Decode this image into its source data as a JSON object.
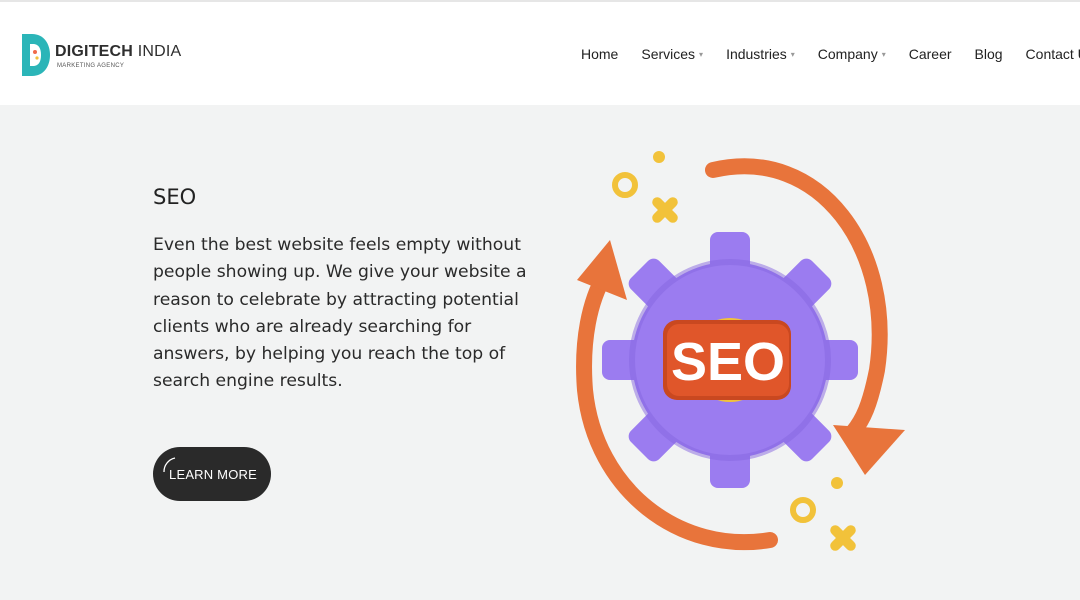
{
  "brand": {
    "name_bold": "DIGITECH",
    "name_rest": " INDIA",
    "tagline": "MARKETING AGENCY",
    "logo_color": "#2bb5b8"
  },
  "nav": {
    "items": [
      {
        "label": "Home"
      },
      {
        "label": "Services",
        "dropdown": true
      },
      {
        "label": "Industries",
        "dropdown": true
      },
      {
        "label": "Company",
        "dropdown": true
      },
      {
        "label": "Career"
      },
      {
        "label": "Blog"
      },
      {
        "label": "Contact Us"
      }
    ]
  },
  "hero": {
    "title": "SEO",
    "description": "Even the best website feels empty without people showing up. We give your website a reason to celebrate by attracting potential clients who are already searching for answers, by helping you reach the top of search engine results.",
    "button_label": "LEARN MORE"
  },
  "illustration": {
    "badge_text": "SEO",
    "icons": [
      "gear-icon",
      "circular-arrows-icon"
    ],
    "colors": {
      "gear": "#9b7cf0",
      "arrows": "#e8743b",
      "badge": "#e0562a",
      "accent": "#f2c23a"
    }
  }
}
